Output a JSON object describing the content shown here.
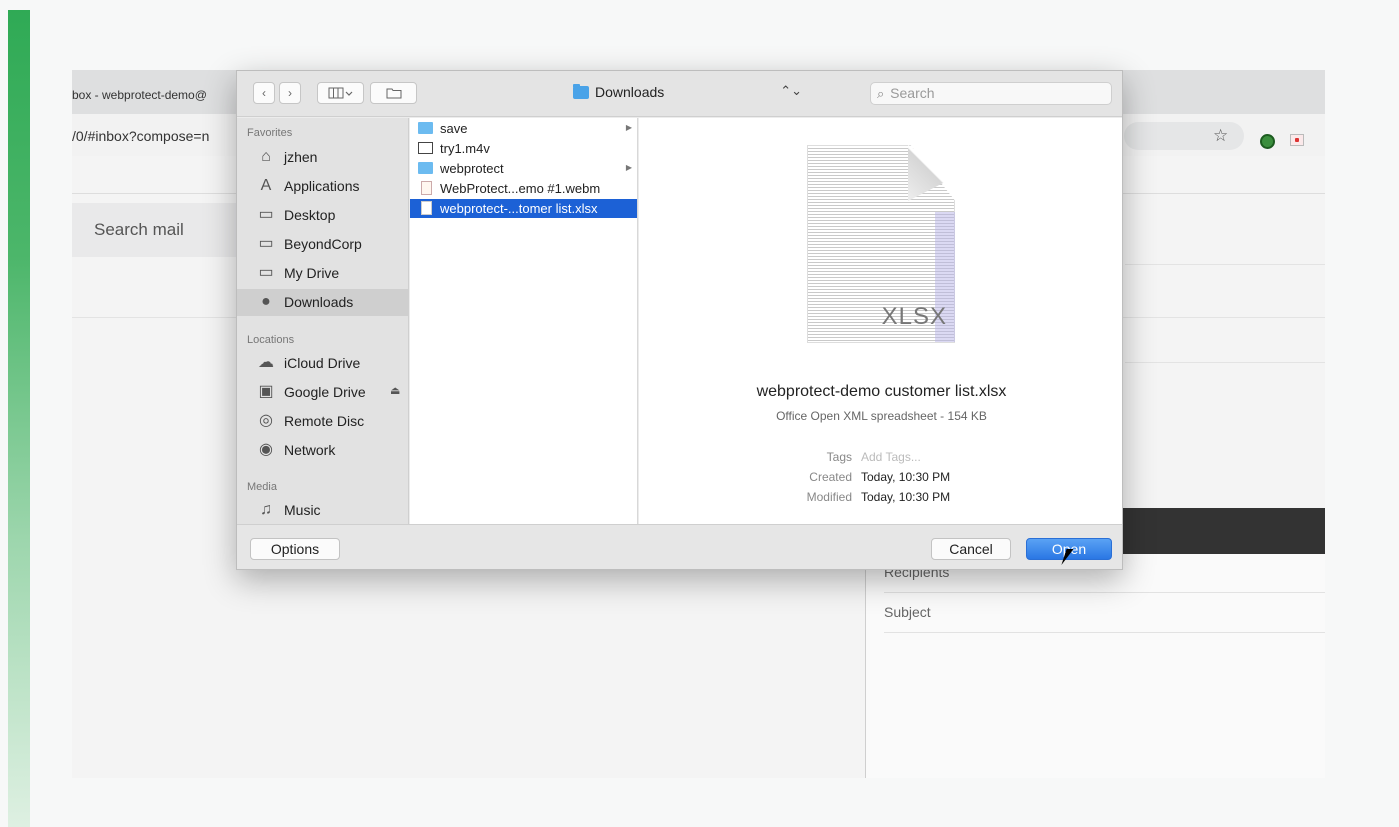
{
  "browser": {
    "tab_title": "box - webprotect-demo@",
    "url": "/0/#inbox?compose=n",
    "star_icon": "star-icon"
  },
  "gmail": {
    "search_placeholder": "Search mail",
    "compose": {
      "recipients_label": "Recipients",
      "subject_label": "Subject"
    }
  },
  "dialog": {
    "toolbar": {
      "back_icon": "‹",
      "forward_icon": "›",
      "view_mode_icon": "columns-view-icon",
      "new_folder_icon": "new-folder-icon",
      "location": "Downloads",
      "search_placeholder": "Search"
    },
    "sidebar": {
      "favorites_heading": "Favorites",
      "favorites": [
        {
          "label": "jzhen",
          "icon": "home-icon"
        },
        {
          "label": "Applications",
          "icon": "applications-icon"
        },
        {
          "label": "Desktop",
          "icon": "desktop-icon"
        },
        {
          "label": "BeyondCorp",
          "icon": "folder-icon"
        },
        {
          "label": "My Drive",
          "icon": "folder-icon"
        },
        {
          "label": "Downloads",
          "icon": "downloads-icon"
        }
      ],
      "locations_heading": "Locations",
      "locations": [
        {
          "label": "iCloud Drive",
          "icon": "cloud-icon"
        },
        {
          "label": "Google Drive",
          "icon": "drive-icon"
        },
        {
          "label": "Remote Disc",
          "icon": "disc-icon"
        },
        {
          "label": "Network",
          "icon": "network-icon"
        }
      ],
      "media_heading": "Media",
      "media": [
        {
          "label": "Music",
          "icon": "music-icon"
        }
      ]
    },
    "files": [
      {
        "name": "save",
        "type": "folder",
        "has_children": true
      },
      {
        "name": "try1.m4v",
        "type": "video",
        "has_children": false
      },
      {
        "name": "webprotect",
        "type": "folder",
        "has_children": true
      },
      {
        "name": "WebProtect...emo #1.webm",
        "type": "webm",
        "has_children": false
      },
      {
        "name": "webprotect-...tomer list.xlsx",
        "type": "document",
        "has_children": false,
        "selected": true
      }
    ],
    "preview": {
      "thumb_label": "XLSX",
      "filename": "webprotect-demo customer list.xlsx",
      "kind": "Office Open XML spreadsheet - 154 KB",
      "tags_label": "Tags",
      "tags_placeholder": "Add Tags...",
      "created_label": "Created",
      "created_value": "Today, 10:30 PM",
      "modified_label": "Modified",
      "modified_value": "Today, 10:30 PM"
    },
    "footer": {
      "options_label": "Options",
      "cancel_label": "Cancel",
      "open_label": "Open"
    }
  },
  "colors": {
    "accent_bar": "#2faa55",
    "selection": "#1c61d6",
    "primary_button": "#2a77e4"
  }
}
